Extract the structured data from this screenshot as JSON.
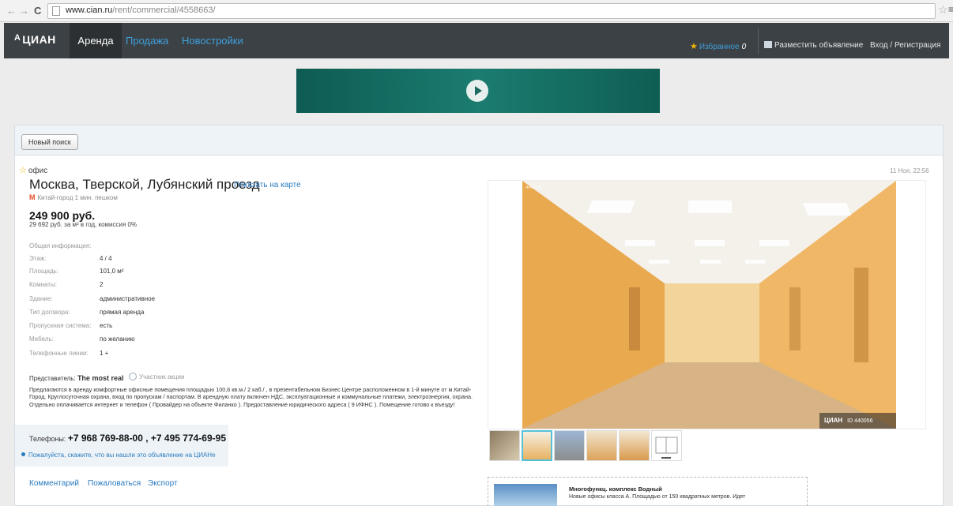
{
  "browser": {
    "url_host": "www.cian.ru",
    "url_path": "/rent/commercial/4558663/"
  },
  "header": {
    "logo": "ЦИАН",
    "nav": {
      "rent": "Аренда",
      "sale": "Продажа",
      "new_buildings": "Новостройки"
    },
    "favorites_label": "Избранное",
    "favorites_count": "0",
    "place_ad": "Разместить объявление",
    "login": "Вход / Регистрация"
  },
  "search": {
    "new_search_label": "Новый поиск"
  },
  "listing": {
    "type": "офис",
    "date": "11 Ноя, 22:56",
    "address": "Москва, Тверской, Лубянский проезд",
    "map_link": "Показать на карте",
    "metro": "Китай-город 1 мин. пешком",
    "price": "249 900 руб.",
    "price_sub": "29 692 руб. за м² в год, комиссия 0%",
    "info_heading": "Общая информация:",
    "info": [
      {
        "label": "Этаж:",
        "value": "4 / 4"
      },
      {
        "label": "Площадь:",
        "value": "101,0 м²"
      },
      {
        "label": "Комнаты:",
        "value": "2"
      },
      {
        "label": "Здание:",
        "value": "административное"
      },
      {
        "label": "Тип договора:",
        "value": "прямая аренда"
      },
      {
        "label": "Пропускная система:",
        "value": "есть"
      },
      {
        "label": "Мебель:",
        "value": "по желанию"
      },
      {
        "label": "Телефонные линии:",
        "value": "1 +"
      }
    ],
    "agent_label": "Представитель:",
    "agent_name": "The most real",
    "promo_badge": "Участник акции",
    "description": "Предлагаются в аренду комфортные офисные помещения площадью 100,6 кв.м./ 2 каб./ , в презентабельном Бизнес Центре расположенном в 1-й минуте от м.Китай-Город. Круглосуточная охрана, вход по пропускам / паспортам. В арендную плату включен НДС, эксплуатационные и коммунальные платежи, электроэнергия, охрана. Отдельно оплачивается интернет и телефон ( Провайдер на объекте Филанко ). Предоставление юридического адреса ( 9 ИФНС ). Помещение готово к въезду!",
    "phones_label": "Телефоны:",
    "phones": "+7 968 769-88-00 , +7 495 774-69-95",
    "ask_cian": "Пожалуйста, скажите, что вы нашли это объявление на ЦИАНе"
  },
  "actions": {
    "comment": "Комментарий",
    "complain": "Пожаловаться",
    "export": "Экспорт"
  },
  "photo": {
    "id_corner": "440056",
    "watermark_brand": "ЦИАН",
    "watermark_id": "ID 440056"
  },
  "promo_card": {
    "title": "Многофункц. комплекс Водный",
    "text": "Новые офисы класса А. Площадью от 150 квадратных метров. Идет"
  }
}
